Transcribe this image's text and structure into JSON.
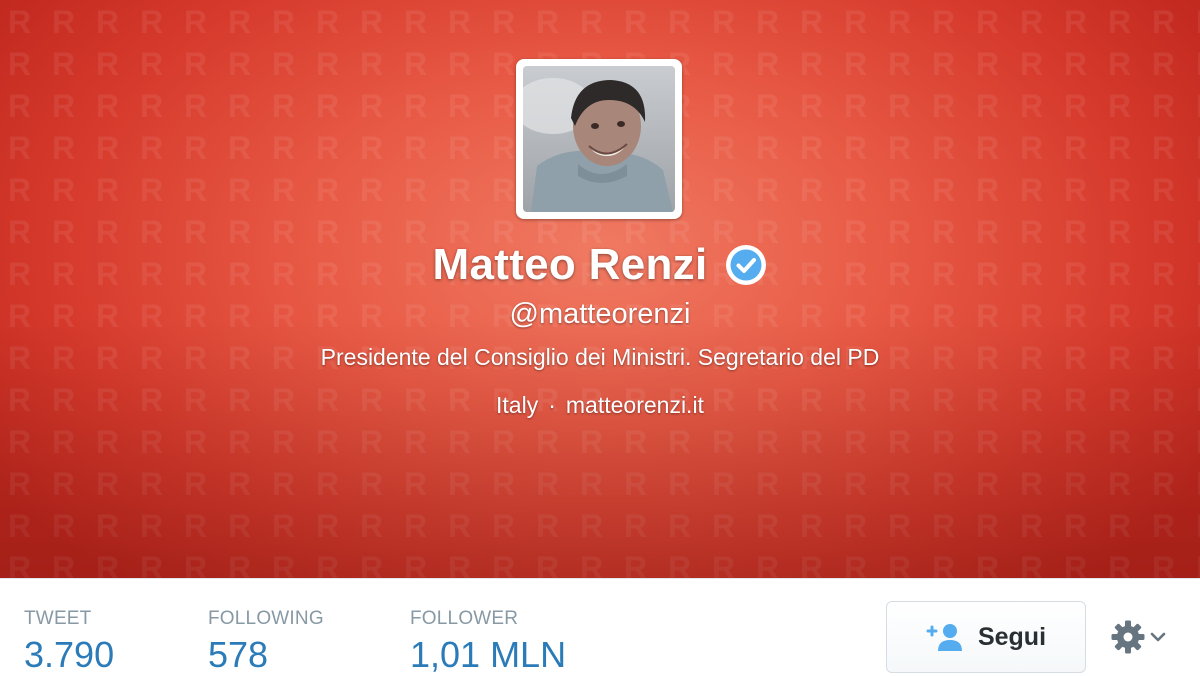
{
  "profile": {
    "name": "Matteo Renzi",
    "verified": true,
    "handle": "@matteorenzi",
    "bio": "Presidente del Consiglio dei Ministri. Segretario del PD",
    "location": "Italy",
    "separator": "·",
    "website": "matteorenzi.it"
  },
  "stats": [
    {
      "label": "TWEET",
      "value": "3.790"
    },
    {
      "label": "FOLLOWING",
      "value": "578"
    },
    {
      "label": "FOLLOWER",
      "value": "1,01 MLN"
    }
  ],
  "actions": {
    "follow_label": "Segui",
    "follow_icon": "add-user-icon",
    "settings_icon": "gear-icon"
  },
  "colors": {
    "banner_red": "#e85a45",
    "link_blue": "#2b7bb9",
    "verified_blue": "#55acee",
    "label_gray": "#8899a6"
  }
}
